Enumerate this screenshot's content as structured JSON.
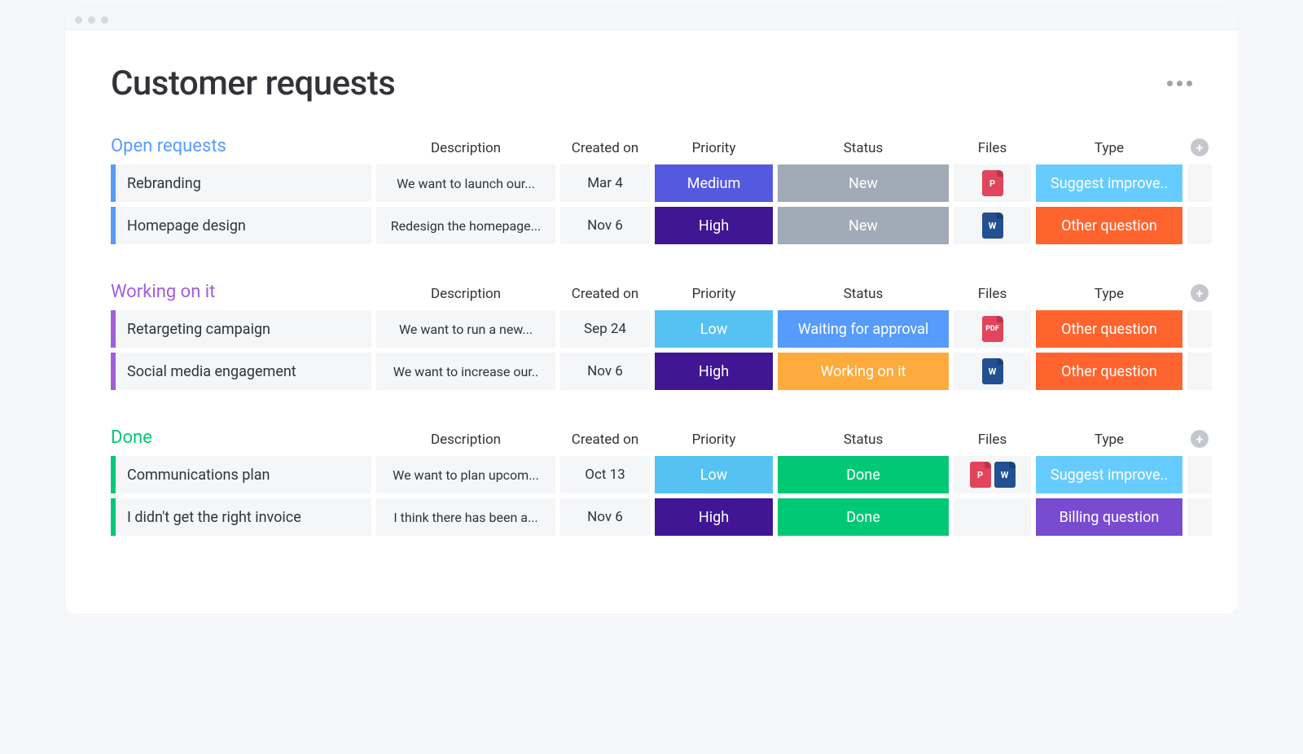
{
  "page_title": "Customer requests",
  "columns": [
    "Description",
    "Created on",
    "Priority",
    "Status",
    "Files",
    "Type"
  ],
  "groups": [
    {
      "title": "Open requests",
      "color": "#579BFC",
      "rows": [
        {
          "name": "Rebranding",
          "desc": "We want to launch our...",
          "created": "Mar 4",
          "priority": {
            "label": "Medium",
            "color": "#5559DF"
          },
          "status": {
            "label": "New",
            "color": "#A1AAB7"
          },
          "files": [
            {
              "label": "P",
              "color": "#E2445C"
            }
          ],
          "type": {
            "label": "Suggest improve..",
            "color": "#66CCFF"
          }
        },
        {
          "name": "Homepage design",
          "desc": "Redesign the homepage...",
          "created": "Nov 6",
          "priority": {
            "label": "High",
            "color": "#401694"
          },
          "status": {
            "label": "New",
            "color": "#A1AAB7"
          },
          "files": [
            {
              "label": "W",
              "color": "#225091"
            }
          ],
          "type": {
            "label": "Other question",
            "color": "#FF642E"
          }
        }
      ]
    },
    {
      "title": "Working on it",
      "color": "#A25DDC",
      "rows": [
        {
          "name": "Retargeting campaign",
          "desc": "We want to run a new...",
          "created": "Sep 24",
          "priority": {
            "label": "Low",
            "color": "#56C2F3"
          },
          "status": {
            "label": "Waiting for approval",
            "color": "#579BFC"
          },
          "files": [
            {
              "label": "PDF",
              "color": "#E2445C"
            }
          ],
          "type": {
            "label": "Other question",
            "color": "#FF642E"
          }
        },
        {
          "name": "Social media engagement",
          "desc": "We want to increase our..",
          "created": "Nov 6",
          "priority": {
            "label": "High",
            "color": "#401694"
          },
          "status": {
            "label": "Working on it",
            "color": "#FDAB3D"
          },
          "files": [
            {
              "label": "W",
              "color": "#225091"
            }
          ],
          "type": {
            "label": "Other question",
            "color": "#FF642E"
          }
        }
      ]
    },
    {
      "title": "Done",
      "color": "#00C875",
      "rows": [
        {
          "name": "Communications plan",
          "desc": "We want to plan upcom...",
          "created": "Oct 13",
          "priority": {
            "label": "Low",
            "color": "#56C2F3"
          },
          "status": {
            "label": "Done",
            "color": "#00C875"
          },
          "files": [
            {
              "label": "P",
              "color": "#E2445C"
            },
            {
              "label": "W",
              "color": "#225091"
            }
          ],
          "type": {
            "label": "Suggest improve..",
            "color": "#66CCFF"
          }
        },
        {
          "name": "I didn't get the right invoice",
          "desc": "I think there has been a...",
          "created": "Nov 6",
          "priority": {
            "label": "High",
            "color": "#401694"
          },
          "status": {
            "label": "Done",
            "color": "#00C875"
          },
          "files": [],
          "type": {
            "label": "Billing question",
            "color": "#784BD1"
          }
        }
      ]
    }
  ]
}
